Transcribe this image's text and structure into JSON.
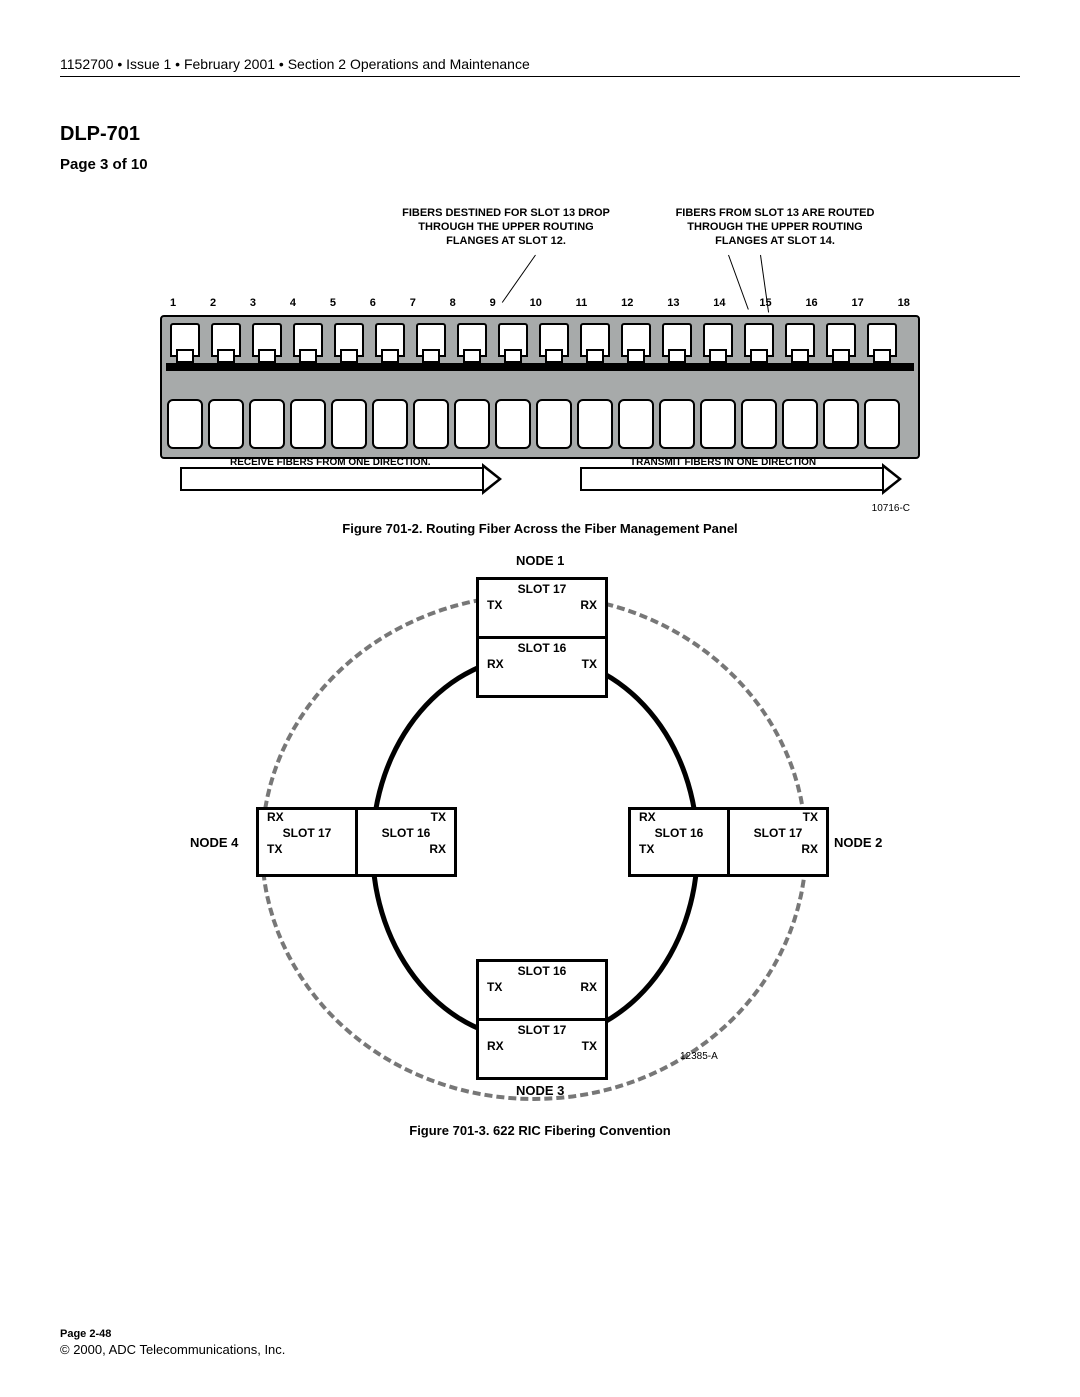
{
  "header": "1152700 • Issue 1 • February 2001 • Section 2 Operations and Maintenance",
  "title": "DLP-701",
  "subpage": "Page 3 of 10",
  "fig1": {
    "noteLeft": "FIBERS DESTINED FOR SLOT 13 DROP THROUGH THE UPPER ROUTING FLANGES AT SLOT 12.",
    "noteRight": "FIBERS FROM SLOT 13 ARE ROUTED THROUGH THE UPPER ROUTING FLANGES AT SLOT 14.",
    "numbers": [
      "1",
      "2",
      "3",
      "4",
      "5",
      "6",
      "7",
      "8",
      "9",
      "10",
      "11",
      "12",
      "13",
      "14",
      "15",
      "16",
      "17",
      "18"
    ],
    "arrowLeft": "RECEIVE FIBERS FROM ONE DIRECTION.",
    "arrowRight": "TRANSMIT FIBERS IN ONE DIRECTION",
    "code": "10716-C",
    "caption": "Figure 701-2. Routing Fiber Across the Fiber Management Panel"
  },
  "fig2": {
    "node1": "NODE 1",
    "node2": "NODE 2",
    "node3": "NODE 3",
    "node4": "NODE 4",
    "slot17": "SLOT 17",
    "slot16": "SLOT 16",
    "tx": "TX",
    "rx": "RX",
    "code": "12385-A",
    "caption": "Figure 701-3. 622 RIC Fibering Convention"
  },
  "footer": {
    "page": "Page 2-48",
    "copy": "© 2000, ADC Telecommunications, Inc."
  }
}
